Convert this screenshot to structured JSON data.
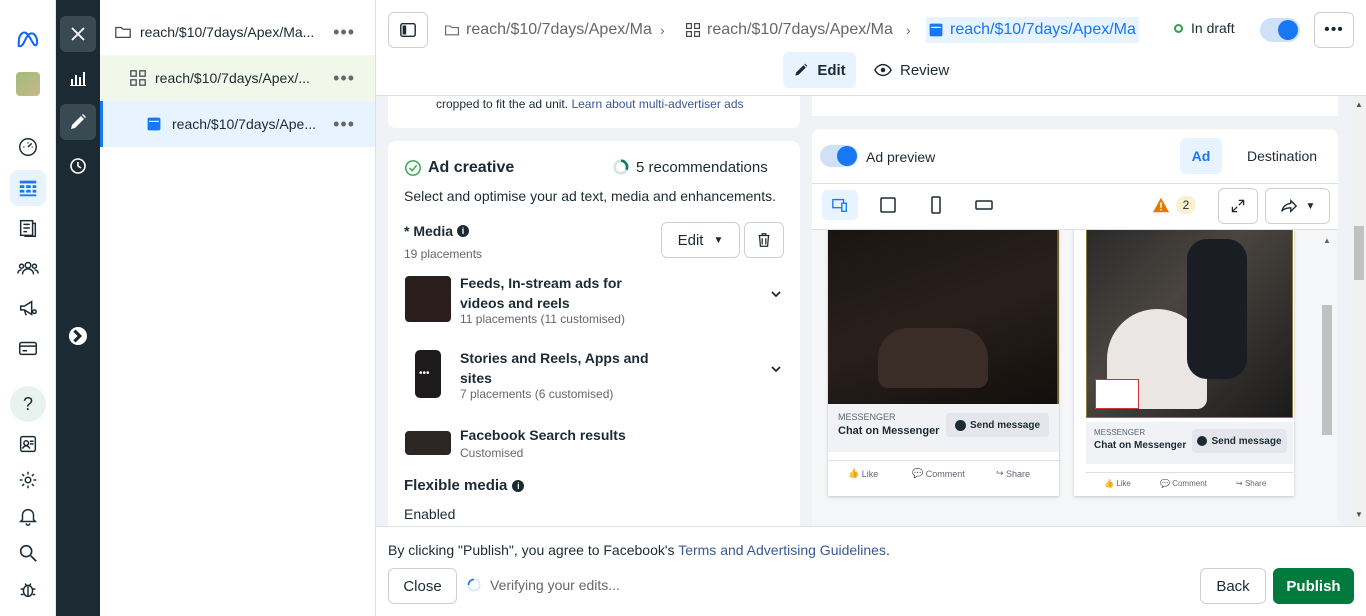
{
  "tree": [
    {
      "label": "reach/$10/7days/Apex/Ma..."
    },
    {
      "label": "reach/$10/7days/Apex/..."
    },
    {
      "label": "reach/$10/7days/Ape..."
    }
  ],
  "topbar": {
    "crumb1": "reach/$10/7days/Apex/Ma",
    "crumb2": "reach/$10/7days/Apex/Ma",
    "crumb3": "reach/$10/7days/Apex/Ma",
    "status": "In draft",
    "edit_label": "Edit",
    "review_label": "Review"
  },
  "main": {
    "multi_text": "cropped to fit the ad unit.",
    "multi_link": "Learn about multi-advertiser ads",
    "creative_title": "Ad creative",
    "recommendations": "5 recommendations",
    "creative_desc": "Select and optimise your ad text, media and enhancements.",
    "media_label": "* Media",
    "media_count": "19 placements",
    "edit_dropdown": "Edit",
    "placements": [
      {
        "title": "Feeds, In-stream ads for",
        "title2": "videos and reels",
        "sub": "11 placements (11 customised)"
      },
      {
        "title": "Stories and Reels, Apps and",
        "title2": "sites",
        "sub": "7 placements (6 customised)"
      },
      {
        "title": "Facebook Search results",
        "title2": "",
        "sub": "Customised"
      }
    ],
    "flexible_label": "Flexible media",
    "flexible_value": "Enabled"
  },
  "preview": {
    "toggle_label": "Ad preview",
    "tab_ad": "Ad",
    "tab_destination": "Destination",
    "warning_count": "2",
    "ads": [
      {
        "cta_source": "MESSENGER",
        "cta_title": "Chat on Messenger",
        "cta_button": "Send message",
        "like": "Like",
        "comment": "Comment",
        "share": "Share"
      },
      {
        "cta_source": "MESSENGER",
        "cta_title": "Chat on Messenger",
        "cta_button": "Send message",
        "like": "Like",
        "comment": "Comment",
        "share": "Share"
      }
    ]
  },
  "bottom": {
    "terms_prefix": "By clicking \"Publish\", you agree to Facebook's",
    "terms_link": "Terms and Advertising Guidelines",
    "terms_suffix": ".",
    "close_label": "Close",
    "verifying": "Verifying your edits...",
    "back_label": "Back",
    "publish_label": "Publish"
  },
  "colors": {
    "accent": "#1877f2",
    "publish": "#007a3d",
    "dark_strip": "#1c2b33",
    "selected_bg": "#e7f3ff"
  }
}
